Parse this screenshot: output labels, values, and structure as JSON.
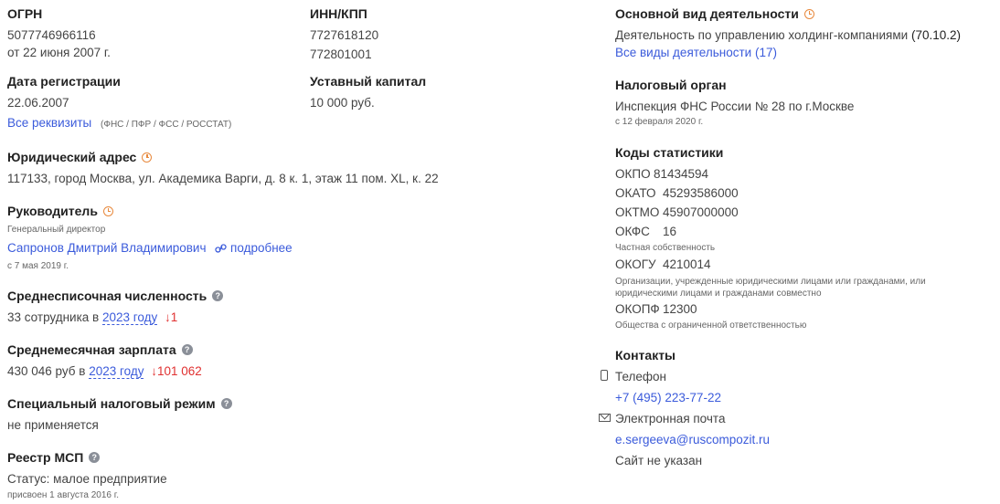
{
  "ogrn": {
    "label": "ОГРН",
    "value": "5077746966116",
    "date": "от 22 июня 2007 г."
  },
  "inn": {
    "label": "ИНН/КПП",
    "inn": "7727618120",
    "kpp": "772801001"
  },
  "registration": {
    "label": "Дата регистрации",
    "value": "22.06.2007",
    "requisites_link": "Все реквизиты",
    "requisites_note": "(ФНС / ПФР / ФСС / РОССТАТ)"
  },
  "capital": {
    "label": "Уставный капитал",
    "value": "10 000 руб."
  },
  "address": {
    "label": "Юридический адрес",
    "value": "117133, город Москва, ул. Академика Варги, д. 8 к. 1, этаж 11 пом. XL, к. 22"
  },
  "head": {
    "label": "Руководитель",
    "position": "Генеральный директор",
    "name": "Сапронов Дмитрий Владимирович",
    "more_link": "подробнее",
    "since": "с 7 мая 2019 г."
  },
  "headcount": {
    "label": "Среднесписочная численность",
    "prefix": "33 сотрудника в",
    "year_link": "2023 году",
    "delta": "↓1"
  },
  "salary": {
    "label": "Среднемесячная зарплата",
    "prefix": "430 046 руб в",
    "year_link": "2023 году",
    "delta": "↓101 062"
  },
  "tax_regime": {
    "label": "Специальный налоговый режим",
    "value": "не применяется"
  },
  "msp": {
    "label": "Реестр МСП",
    "status": "Статус: малое предприятие",
    "assigned": "присвоен 1 августа 2016 г."
  },
  "activity": {
    "label": "Основной вид деятельности",
    "value": "Деятельность по управлению холдинг-компаниями",
    "code": "(70.10.2)",
    "all_link": "Все виды деятельности (17)"
  },
  "tax_office": {
    "label": "Налоговый орган",
    "value": "Инспекция ФНС России № 28 по г.Москве",
    "since": "с 12 февраля 2020 г."
  },
  "stats": {
    "label": "Коды статистики",
    "okpo": {
      "name": "ОКПО",
      "value": "81434594"
    },
    "okato": {
      "name": "ОКАТО",
      "value": "45293586000"
    },
    "oktmo": {
      "name": "ОКТМО",
      "value": "45907000000"
    },
    "okfs": {
      "name": "ОКФС",
      "value": "16",
      "desc": "Частная собственность"
    },
    "okogu": {
      "name": "ОКОГУ",
      "value": "4210014",
      "desc": "Организации, учрежденные юридическими лицами или гражданами, или юридическими лицами и гражданами совместно"
    },
    "okopf": {
      "name": "ОКОПФ",
      "value": "12300",
      "desc": "Общества с ограниченной ответственностью"
    }
  },
  "contacts": {
    "label": "Контакты",
    "phone_label": "Телефон",
    "phone": "+7 (495) 223-77-22",
    "email_label": "Электронная почта",
    "email": "e.sergeeva@ruscompozit.ru",
    "site": "Сайт не указан"
  },
  "colors": {
    "link": "#3b5bdb",
    "negative": "#e03131",
    "clock_icon": "#e8893d"
  }
}
